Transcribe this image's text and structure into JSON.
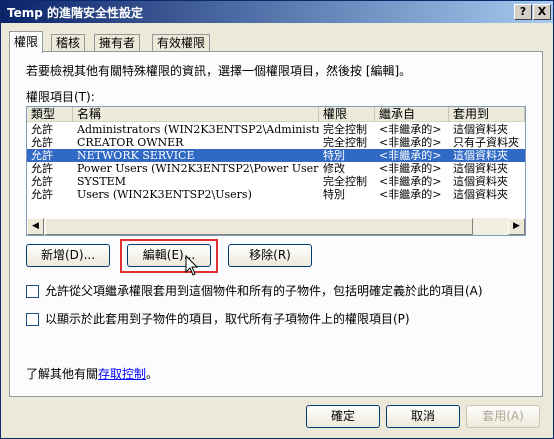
{
  "window": {
    "title": "Temp 的進階安全性設定"
  },
  "titlebar_buttons": {
    "help": "?",
    "close": "X"
  },
  "tabs": [
    {
      "label": "權限",
      "active": true
    },
    {
      "label": "稽核",
      "active": false
    },
    {
      "label": "擁有者",
      "active": false
    },
    {
      "label": "有效權限",
      "active": false
    }
  ],
  "instruction": "若要檢視其他有關特殊權限的資訊，選擇一個權限項目，然後按 [編輯]。",
  "permissions": {
    "label": "權限項目(T):",
    "columns": [
      "類型",
      "名稱",
      "權限",
      "繼承自",
      "套用到"
    ],
    "rows": [
      {
        "type": "允許",
        "name": "Administrators (WIN2K3ENTSP2\\Administrators)",
        "permission": "完全控制",
        "inherited": "<非繼承的>",
        "apply_to": "這個資料夾",
        "selected": false
      },
      {
        "type": "允許",
        "name": "CREATOR OWNER",
        "permission": "完全控制",
        "inherited": "<非繼承的>",
        "apply_to": "只有子資料夾",
        "selected": false
      },
      {
        "type": "允許",
        "name": "NETWORK SERVICE",
        "permission": "特別",
        "inherited": "<非繼承的>",
        "apply_to": "這個資料夾",
        "selected": true
      },
      {
        "type": "允許",
        "name": "Power Users (WIN2K3ENTSP2\\Power Users)",
        "permission": "修改",
        "inherited": "<非繼承的>",
        "apply_to": "這個資料夾",
        "selected": false
      },
      {
        "type": "允許",
        "name": "SYSTEM",
        "permission": "完全控制",
        "inherited": "<非繼承的>",
        "apply_to": "這個資料夾",
        "selected": false
      },
      {
        "type": "允許",
        "name": "Users (WIN2K3ENTSP2\\Users)",
        "permission": "特別",
        "inherited": "<非繼承的>",
        "apply_to": "這個資料夾",
        "selected": false
      }
    ]
  },
  "buttons": {
    "add": "新增(D)...",
    "edit": "編輯(E)...",
    "remove": "移除(R)"
  },
  "checks": {
    "inherit": "允許從父項繼承權限套用到這個物件和所有的子物件，包括明確定義於此的項目(A)",
    "replace": "以顯示於此套用到子物件的項目，取代所有子項物件上的權限項目(P)"
  },
  "learn_more": {
    "prefix": "了解其他有關",
    "link": "存取控制",
    "suffix": "。"
  },
  "footer": {
    "ok": "確定",
    "cancel": "取消",
    "apply": "套用(A)"
  },
  "colors": {
    "selection": "#316ac5",
    "highlight": "#e03030",
    "title_start": "#0a246a",
    "title_end": "#a6caf0"
  }
}
